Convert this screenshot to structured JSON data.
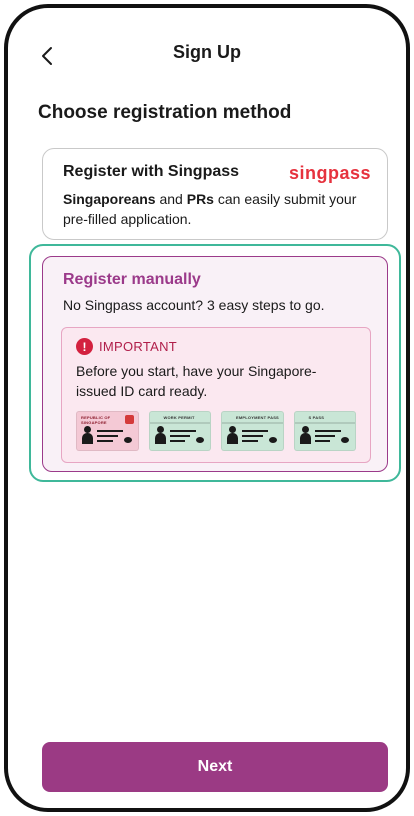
{
  "header": {
    "title": "Sign Up",
    "back_icon": "chevron-left-icon"
  },
  "main": {
    "section_title": "Choose registration method",
    "singpass_card": {
      "title": "Register with Singpass",
      "logo_text": "singpass",
      "desc_bold_1": "Singaporeans",
      "desc_mid": " and ",
      "desc_bold_2": "PRs",
      "desc_rest": " can easily submit your pre-filled application."
    },
    "manual_card": {
      "title": "Register manually",
      "desc": "No Singpass account? 3 easy steps to go.",
      "important": {
        "icon": "exclamation-icon",
        "label": "IMPORTANT",
        "text": "Before you start, have your Singapore-issued ID card ready."
      },
      "id_cards": [
        {
          "label": "REPUBLIC OF SINGAPORE",
          "color": "#f4c9d5"
        },
        {
          "label": "WORK PERMIT",
          "color": "#c9e6d6"
        },
        {
          "label": "EMPLOYMENT PASS",
          "color": "#c9e6d6"
        },
        {
          "label": "S PASS",
          "color": "#c9e6d6"
        }
      ]
    }
  },
  "footer": {
    "next_label": "Next"
  },
  "colors": {
    "accent": "#9b3a84",
    "selection_outline": "#3fb89a",
    "singpass_red": "#e6323e",
    "important_red": "#d3213f"
  }
}
